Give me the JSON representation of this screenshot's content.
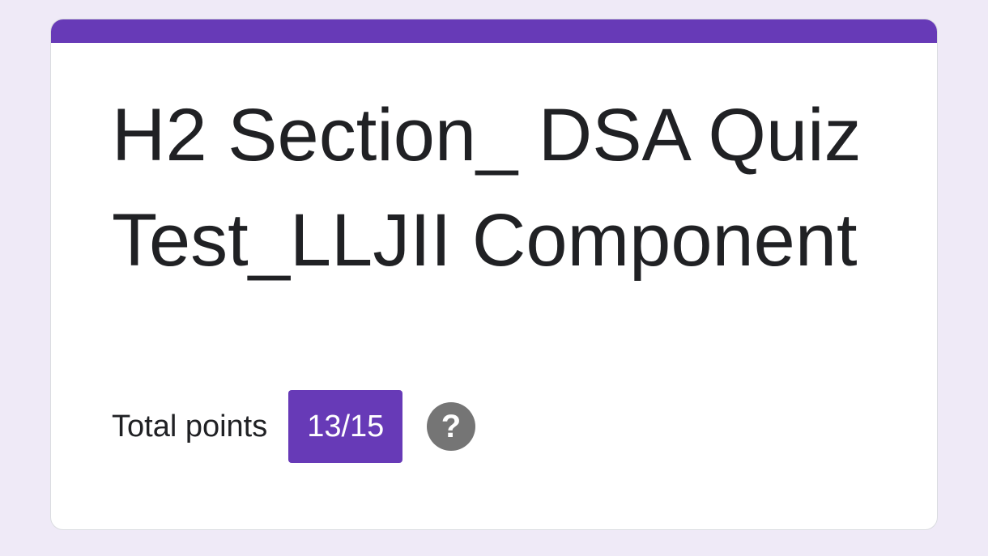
{
  "form": {
    "title": "H2 Section_ DSA Quiz Test_LLJII Component",
    "total_points_label": "Total points",
    "score": "13/15",
    "score_fraction": 0.8667,
    "help_icon": "help-circle-icon",
    "help_glyph": "?"
  },
  "colors": {
    "accent": "#673ab7",
    "background": "#efeaf7",
    "card": "#ffffff",
    "text": "#202124",
    "icon": "#757575"
  }
}
